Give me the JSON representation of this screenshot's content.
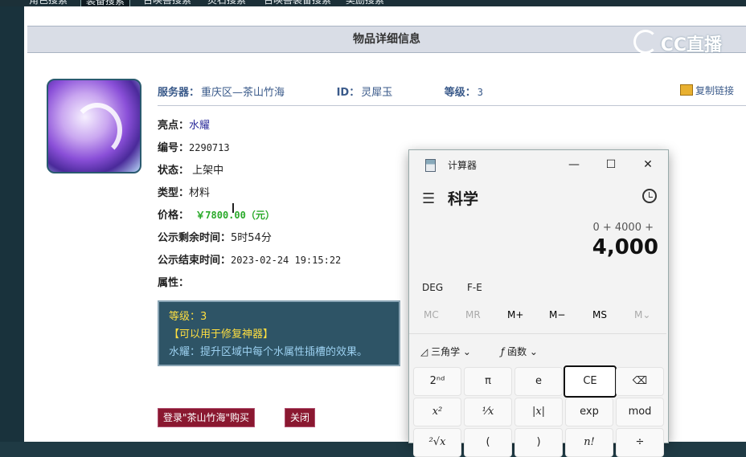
{
  "top_nav": {
    "tabs": [
      "角色搜索",
      "装备搜索",
      "召唤兽搜索",
      "灵石搜索",
      "召唤兽装备搜索",
      "奖励搜索"
    ],
    "active_tab": "装备搜索"
  },
  "panel": {
    "title": "物品详细信息",
    "brand": "CC直播"
  },
  "item": {
    "server_label": "服务器：",
    "server": "重庆区—茶山竹海",
    "id_label": "ID：",
    "id": "灵犀玉",
    "level_label": "等级：",
    "level": "3",
    "copy_link": "复制链接",
    "highlight_label": "亮点：",
    "highlight": "水耀",
    "number_label": "编号：",
    "number": "2290713",
    "status_label": "状态：",
    "status": "上架中",
    "type_label": "类型：",
    "type": "材料",
    "price_label": "价格：",
    "price": "￥7800.00（元）",
    "remaining_label": "公示剩余时间：",
    "remaining": "5时54分",
    "end_label": "公示结束时间：",
    "end": "2023-02-24 19:15:22",
    "attr_label": "属性："
  },
  "description": {
    "line1": "等级：3",
    "line2": "【可以用于修复神器】",
    "line3": "水耀：提升区域中每个水属性插槽的效果。"
  },
  "buttons": {
    "buy": "登录\"茶山竹海\"购买",
    "close": "关闭"
  },
  "calculator": {
    "title": "计算器",
    "mode": "科学",
    "expression": "0 + 4000 +",
    "result": "4,000",
    "deg": "DEG",
    "fe": "F-E",
    "memory": [
      "MC",
      "MR",
      "M+",
      "M−",
      "MS",
      "M⌄"
    ],
    "trig": "三角学",
    "func": "函数",
    "keys_row1": [
      "2ⁿᵈ",
      "π",
      "e",
      "CE",
      "⌫"
    ],
    "keys_row2": [
      "x²",
      "¹⁄x",
      "|x|",
      "exp",
      "mod"
    ],
    "keys_row3": [
      "²√x",
      "(",
      ")",
      "n!",
      "÷"
    ]
  }
}
